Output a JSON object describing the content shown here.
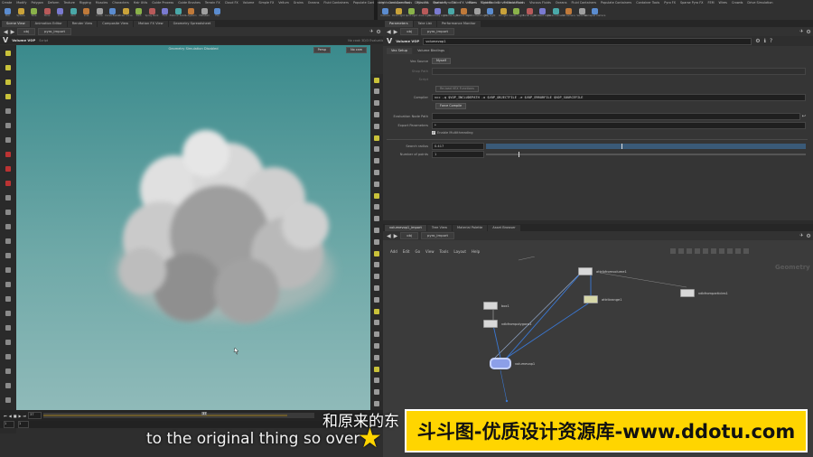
{
  "menubar": {
    "left_tabs": [
      "Create",
      "Modify",
      "Polygon",
      "Deform",
      "Texture",
      "Rigging",
      "Muscles",
      "Characters",
      "Hair Utils",
      "Guide Process",
      "Guide Brushes",
      "Terrain FX",
      "Cloud FX",
      "Volume",
      "Simple FX",
      "Vellum",
      "Grains",
      "Oceans",
      "Fluid Containers",
      "Populate Containers",
      "Container Tools",
      "Pyro FX",
      "Sparse Pyro FX",
      "FX",
      "Wires",
      "Crowds",
      "Drive Simulation"
    ],
    "left_tools": [
      "Box",
      "Sphere",
      "Tube",
      "Torus",
      "Grid",
      "Null",
      "Line",
      "Circle",
      "Curve Bezier",
      "Draw Curve",
      "Path",
      "Spray Paint",
      "Font",
      "Platonic Solids",
      "L-System",
      "Metaball",
      "File"
    ],
    "right_tabs": [
      "Lights and Cameras",
      "Collisions",
      "Particles",
      "Grains",
      "Vellum",
      "Rigid Bodies",
      "Particle Fluids",
      "Viscous Fluids",
      "Oceans",
      "Fluid Containers",
      "Populate Containers",
      "Container Tools",
      "Pyro FX",
      "Sparse Pyro FX",
      "FEM",
      "Wires",
      "Crowds",
      "Drive Simulation"
    ],
    "right_tools": [
      "Camera",
      "Point Light",
      "Spot Light",
      "Area Light",
      "Geometry Light",
      "Volume Light",
      "Distant Light",
      "Environment Light",
      "Sky Light",
      "GI Light",
      "Caustic Light",
      "Portal Light",
      "Ambient Light",
      "Stereo Camera",
      "VR Camera",
      "Switcher",
      "Gamepad Camera"
    ]
  },
  "left_pane": {
    "tabs": [
      "Scene View",
      "Animation Editor",
      "Render View",
      "Composite View",
      "Motion FX View",
      "Geometry Spreadsheet"
    ],
    "path": [
      "obj",
      "pyro_import"
    ],
    "node_name": "Volume VOP",
    "node_sub": "Script",
    "viewport_status": "No cook 3D/3 Evaluation",
    "viewport_header": "Geometry Simulation Disabled",
    "persp_label": "Persp",
    "cam_label": "No cam",
    "frame": "37",
    "timeline_start": "1",
    "timeline_end": "1",
    "timeline_marker": "37"
  },
  "param_pane": {
    "tabs": [
      "Parameters",
      "Take List",
      "Performance Monitor"
    ],
    "path": [
      "obj",
      "pyro_import"
    ],
    "node_type": "Volume VOP",
    "node_name": "volumevop1",
    "subtabs": [
      "Vex Setup",
      "Volume Bindings"
    ],
    "vex_source_label": "Vex Source",
    "vex_source_value": "Myself",
    "shop_path_label": "Shop Path",
    "script_label": "Script",
    "script_button": "Re-load VEX Functions",
    "compiler_label": "Compiler",
    "compiler_value": "vcc -q $VOP_INCLUDEPATH -o $VOP_OBJECTFILE -e $VOP_ERRORFILE $VOP_SOURCEFILE",
    "force_compile": "Force Compile",
    "eval_node_path_label": "Evaluation Node Path",
    "export_params_label": "Export Parameters",
    "export_params_value": "*",
    "multithreading": "Enable Multithreading",
    "search_radius_label": "Search radius",
    "search_radius_value": "0.417",
    "num_points_label": "Number of points",
    "num_points_value": "1"
  },
  "network_pane": {
    "tabs": [
      "volumevop1_import",
      "Tree View",
      "Material Palette",
      "Asset Browser"
    ],
    "path": [
      "obj",
      "pyro_import"
    ],
    "menus": [
      "Add",
      "Edit",
      "Go",
      "View",
      "Tools",
      "Layout",
      "Help"
    ],
    "context_label": "Geometry",
    "nodes": [
      "attribfromvolume1",
      "box1",
      "attribrange1",
      "vdbfromparticles1",
      "vdbfrompolygons1",
      "volumevop1"
    ]
  },
  "subtitles": {
    "cn": "和原来的东",
    "en": "to the original thing so over"
  },
  "banner": {
    "text": "斗斗图-优质设计资源库-www.ddotu.com"
  },
  "colors": {
    "viewport_top": "#3a8a8c",
    "viewport_bottom": "#93bcbb",
    "banner": "#ffd500"
  }
}
